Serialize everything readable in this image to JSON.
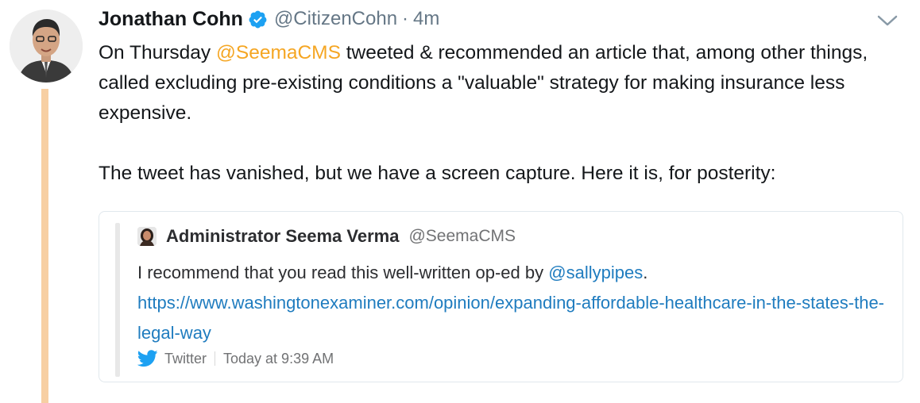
{
  "tweet": {
    "author_name": "Jonathan Cohn",
    "author_handle": "@CitizenCohn",
    "separator": "·",
    "time": "4m",
    "para1": {
      "prefix": "On Thursday ",
      "mention": "@SeemaCMS",
      "suffix": " tweeted & recommended an article that, among other things, called excluding pre-existing conditions a \"valuable\" strategy for making insurance less expensive."
    },
    "para2": "The tweet has vanished, but we have a screen capture. Here it is, for posterity:"
  },
  "card": {
    "author_name": "Administrator Seema Verma",
    "author_handle": "@SeemaCMS",
    "text_prefix": "I recommend that you read this well-written op-ed by ",
    "text_mention": "@sallypipes",
    "text_suffix": ".",
    "url": "https://www.washingtonexaminer.com/opinion/expanding-affordable-healthcare-in-the-states-the-legal-way",
    "source": "Twitter",
    "timestamp": "Today at 9:39 AM"
  },
  "colors": {
    "mention": "#f5a623",
    "verified": "#1da1f2",
    "thread_line": "#f7cfa3",
    "link": "#1f7cbf",
    "twitter_bird": "#1da1f2"
  },
  "icons": {
    "verified": "verified-badge-icon",
    "caret": "chevron-down-icon",
    "bird": "twitter-bird-icon"
  }
}
